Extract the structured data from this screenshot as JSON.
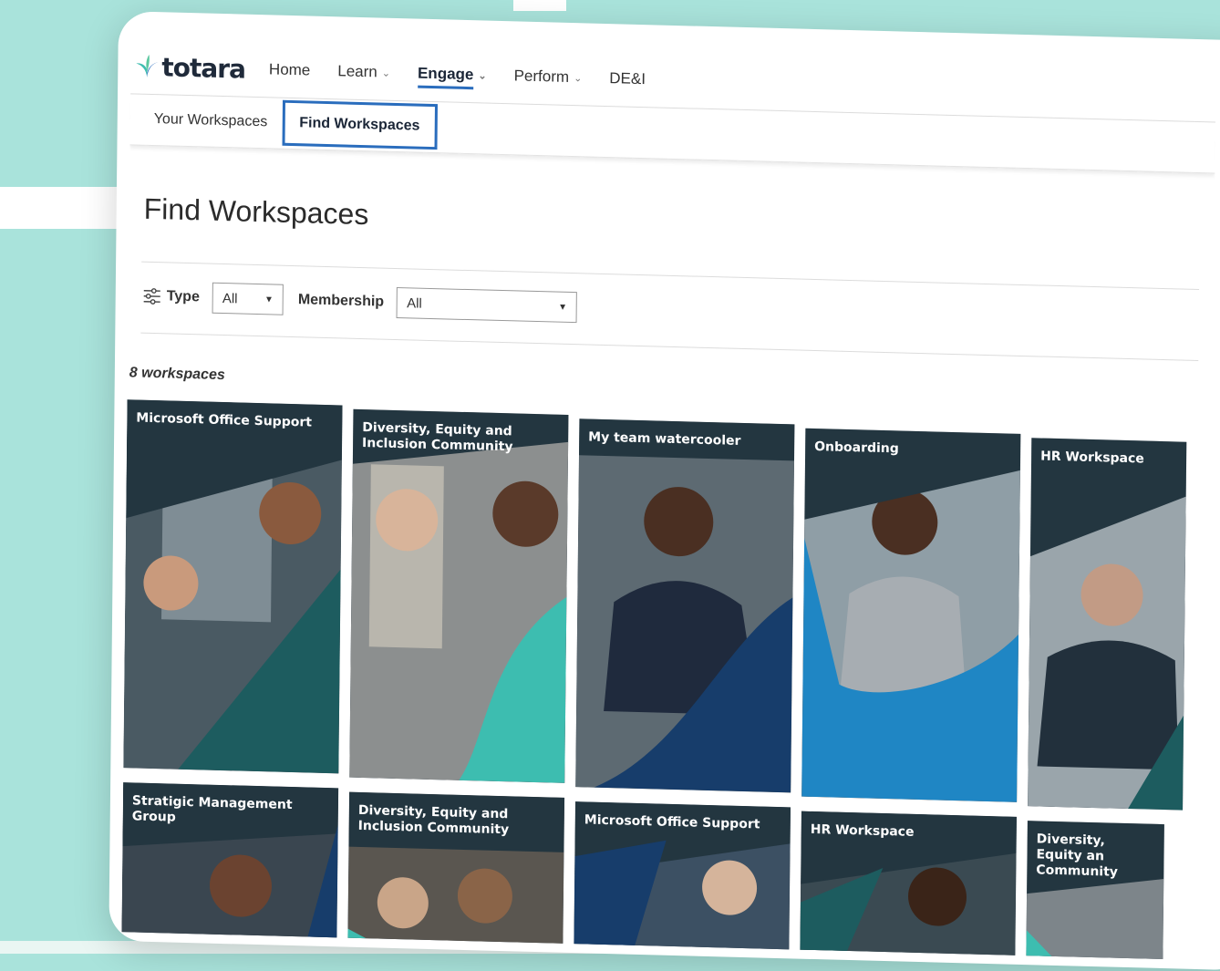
{
  "brand": {
    "name": "totara"
  },
  "nav": {
    "items": [
      {
        "label": "Home",
        "has_dropdown": false,
        "active": false
      },
      {
        "label": "Learn",
        "has_dropdown": true,
        "active": false
      },
      {
        "label": "Engage",
        "has_dropdown": true,
        "active": true
      },
      {
        "label": "Perform",
        "has_dropdown": true,
        "active": false
      },
      {
        "label": "DE&I",
        "has_dropdown": false,
        "active": false
      }
    ]
  },
  "subtabs": [
    {
      "label": "Your Workspaces",
      "active": false
    },
    {
      "label": "Find Workspaces",
      "active": true
    }
  ],
  "page": {
    "title": "Find Workspaces"
  },
  "filters": {
    "type_label": "Type",
    "type_value": "All",
    "membership_label": "Membership",
    "membership_value": "All"
  },
  "results": {
    "count_text": "8 workspaces"
  },
  "colors": {
    "accent": "#2a6dbd",
    "teal_dark": "#1d5c5f",
    "teal": "#3dbdb0",
    "navy": "#173d6b",
    "blue": "#1f86c4"
  },
  "cards_row1": [
    {
      "title": "Microsoft  Office Support",
      "shape": "teal_dark"
    },
    {
      "title": "Diversity, Equity and Inclusion Community",
      "shape": "teal"
    },
    {
      "title": "My team watercooler",
      "shape": "navy"
    },
    {
      "title": "Onboarding",
      "shape": "blue"
    },
    {
      "title": "HR Workspace",
      "shape": "teal_dark"
    }
  ],
  "cards_row2": [
    {
      "title": "Stratigic Management Group",
      "shape": "navy"
    },
    {
      "title": "Diversity, Equity and Inclusion Community",
      "shape": "teal"
    },
    {
      "title": "Microsoft Office Support",
      "shape": "navy"
    },
    {
      "title": "HR Workspace",
      "shape": "teal_dark"
    },
    {
      "title": "Diversity, Equity an Community",
      "shape": "teal"
    }
  ]
}
